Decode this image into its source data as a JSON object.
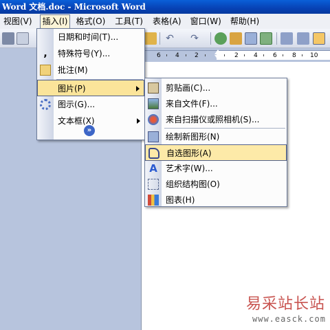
{
  "window": {
    "title": "Word 文档.doc - Microsoft Word"
  },
  "menubar": {
    "items": [
      "视图(V)",
      "插入(I)",
      "格式(O)",
      "工具(T)",
      "表格(A)",
      "窗口(W)",
      "帮助(H)"
    ]
  },
  "ruler": {
    "labels": [
      "6",
      "4",
      "2",
      "2",
      "4",
      "6",
      "8",
      "10"
    ]
  },
  "insert_menu": {
    "items": [
      {
        "label": "日期和时间(T)...",
        "icon": "calendar-icon"
      },
      {
        "label": "特殊符号(Y)...",
        "icon": "symbol-icon"
      },
      {
        "label": "批注(M)",
        "icon": "comment-icon"
      },
      {
        "label": "图片(P)",
        "icon": "none",
        "submenu": true,
        "highlighted": true
      },
      {
        "label": "图示(G)...",
        "icon": "diagram-icon"
      },
      {
        "label": "文本框(X)",
        "icon": "none",
        "submenu": true
      }
    ]
  },
  "picture_submenu": {
    "items": [
      {
        "label": "剪贴画(C)...",
        "icon": "clipart-icon"
      },
      {
        "label": "来自文件(F)...",
        "icon": "picture-file-icon"
      },
      {
        "label": "来自扫描仪或照相机(S)...",
        "icon": "scanner-icon"
      },
      {
        "label": "绘制新图形(N)",
        "icon": "new-drawing-icon"
      },
      {
        "label": "自选图形(A)",
        "icon": "autoshape-icon",
        "highlighted": true
      },
      {
        "label": "艺术字(W)...",
        "icon": "wordart-icon"
      },
      {
        "label": "组织结构图(O)",
        "icon": "org-chart-icon"
      },
      {
        "label": "图表(H)",
        "icon": "chart-icon"
      }
    ]
  },
  "watermark": {
    "text": "易采站长站",
    "url": "www.easck.com"
  },
  "colors": {
    "titlebar": "#0742b5",
    "highlight": "#fbe49a",
    "menu_border": "#6b7a99",
    "canvas": "#b7c4dd"
  }
}
